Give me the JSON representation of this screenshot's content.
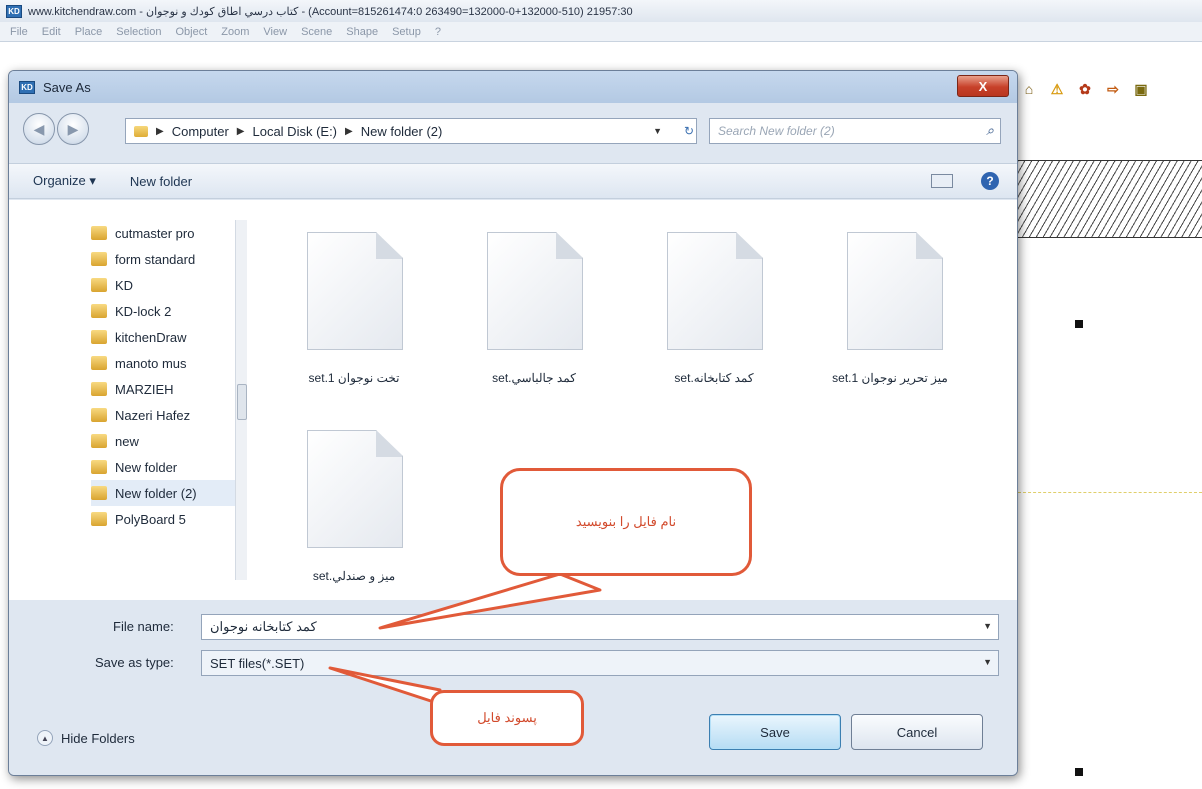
{
  "app": {
    "title": "www.kitchendraw.com - كتاب درسي اطاق كودك و نوجوان - (Account=815261474:0 263490=132000-0+132000-510) 21957:30",
    "logo": "KD",
    "menu": [
      "File",
      "Edit",
      "Place",
      "Selection",
      "Object",
      "Zoom",
      "View",
      "Scene",
      "Shape",
      "Setup",
      "?"
    ]
  },
  "dialog": {
    "title": "Save As",
    "close_label": "X",
    "address": {
      "segments": [
        "Computer",
        "Local Disk (E:)",
        "New folder (2)"
      ]
    },
    "search_placeholder": "Search New folder (2)",
    "organize_label": "Organize ▾",
    "new_folder_label": "New folder",
    "nav_items": [
      "cutmaster pro",
      "form standard",
      "KD",
      "KD-lock 2",
      "kitchenDraw",
      "manoto mus",
      "MARZIEH",
      "Nazeri Hafez",
      "new",
      "New folder",
      "New folder (2)",
      "PolyBoard 5"
    ],
    "files": [
      "تخت نوجوان 1.set",
      "كمد جالباسي.set",
      "كمد كتابخانه.set",
      "ميز تحرير نوجوان 1.set",
      "ميز و صندلي.set"
    ],
    "file_name_label": "File name:",
    "file_name_value": "كمد كتابخانه نوجوان",
    "save_type_label": "Save as type:",
    "save_type_value": "SET files(*.SET)",
    "hide_folders_label": "Hide Folders",
    "save_label": "Save",
    "cancel_label": "Cancel"
  },
  "callouts": {
    "filename_note": "نام فايل را بنويسيد",
    "extension_note": "پسوند فايل"
  },
  "colors": {
    "callout_border": "#e15a39",
    "close_button": "#c7412a",
    "dialog_frame": "#dfe7f1"
  }
}
